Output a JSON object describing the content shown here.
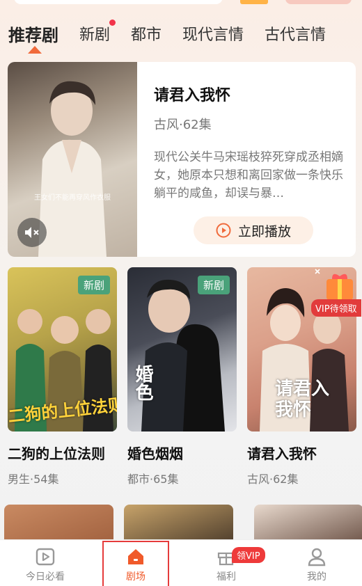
{
  "tabs": [
    {
      "label": "推荐剧",
      "active": true
    },
    {
      "label": "新剧",
      "dot": true
    },
    {
      "label": "都市"
    },
    {
      "label": "现代言情"
    },
    {
      "label": "古代言情"
    }
  ],
  "featured": {
    "title": "请君入我怀",
    "meta": "古风·62集",
    "description": "现代公关牛马宋瑶枝猝死穿成丞相嫡女，她原本只想和离回家做一条快乐躺平的咸鱼，却误与暴…",
    "poster_caption": "王女们不能再穿风作衣服",
    "play_label": "立即播放"
  },
  "cards": [
    {
      "title": "二狗的上位法则",
      "meta": "男生·54集",
      "badge": "新剧",
      "poster_text": "二狗的上位法则"
    },
    {
      "title": "婚色烟烟",
      "meta": "都市·65集",
      "badge": "新剧",
      "poster_text": "婚色"
    },
    {
      "title": "请君入我怀",
      "meta": "古风·62集",
      "badge": "",
      "poster_text": "请君入我怀"
    }
  ],
  "vip_float": {
    "label": "VIP待领取"
  },
  "bottom_nav": [
    {
      "label": "今日必看",
      "icon": "play-square-icon"
    },
    {
      "label": "剧场",
      "icon": "home-icon",
      "active": true
    },
    {
      "label": "福利",
      "icon": "gift-icon",
      "badge": "领VIP"
    },
    {
      "label": "我的",
      "icon": "user-icon"
    }
  ],
  "colors": {
    "accent": "#f06a3b",
    "badge_green": "#4aa27a",
    "vip_red": "#e23b3b"
  }
}
